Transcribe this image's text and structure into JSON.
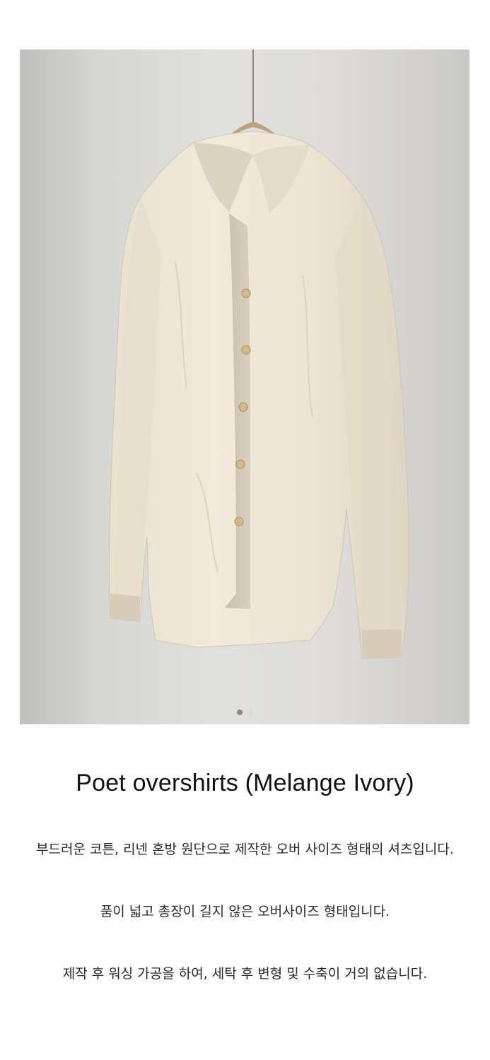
{
  "product": {
    "title": "Poet overshirts (Melange Ivory)",
    "image": {
      "subject": "ivory linen-cotton overshirt on hanger",
      "carousel": {
        "total": 2,
        "active": 1
      }
    },
    "description": [
      "부드러운 코튼, 리넨 혼방 원단으로 제작한 오버 사이즈 형태의 셔츠입니다.",
      "품이 넓고 총장이 길지 않은 오버사이즈 형태입니다.",
      "제작 후 워싱 가공을 하여, 세탁 후 변형 및 수축이 거의 없습니다."
    ]
  },
  "colors": {
    "background": "#ffffff",
    "shirt": "#efe7d6",
    "wall": "#d9d9d6",
    "text": "#222222"
  }
}
